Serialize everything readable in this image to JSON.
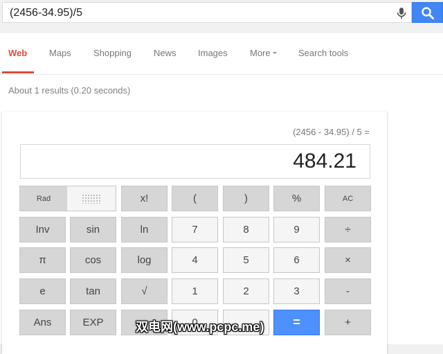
{
  "search": {
    "query": "(2456-34.95)/5"
  },
  "nav": {
    "items": [
      {
        "label": "Web",
        "active": true
      },
      {
        "label": "Maps"
      },
      {
        "label": "Shopping"
      },
      {
        "label": "News"
      },
      {
        "label": "Images"
      },
      {
        "label": "More"
      },
      {
        "label": "Search tools"
      }
    ]
  },
  "results": {
    "stats": "About 1 results (0.20 seconds)"
  },
  "calculator": {
    "history": "(2456 - 34.95) / 5 =",
    "display": "484.21",
    "rad_label": "Rad",
    "keys": {
      "fact": "x!",
      "lparen": "(",
      "rparen": ")",
      "percent": "%",
      "ac": "AC",
      "inv": "Inv",
      "sin": "sin",
      "ln": "ln",
      "seven": "7",
      "eight": "8",
      "nine": "9",
      "divide": "÷",
      "pi": "π",
      "cos": "cos",
      "log": "log",
      "four": "4",
      "five": "5",
      "six": "6",
      "multiply": "×",
      "e": "e",
      "tan": "tan",
      "sqrt": "√",
      "one": "1",
      "two": "2",
      "three": "3",
      "minus": "-",
      "ans": "Ans",
      "exp": "EXP",
      "zero": "0",
      "equals": "=",
      "plus": "+"
    }
  },
  "watermark": "双电网(www.pcpc.me)",
  "colors": {
    "accent": "#dd4b39",
    "search_button": "#4285f4",
    "equals_key": "#4d90fe"
  }
}
